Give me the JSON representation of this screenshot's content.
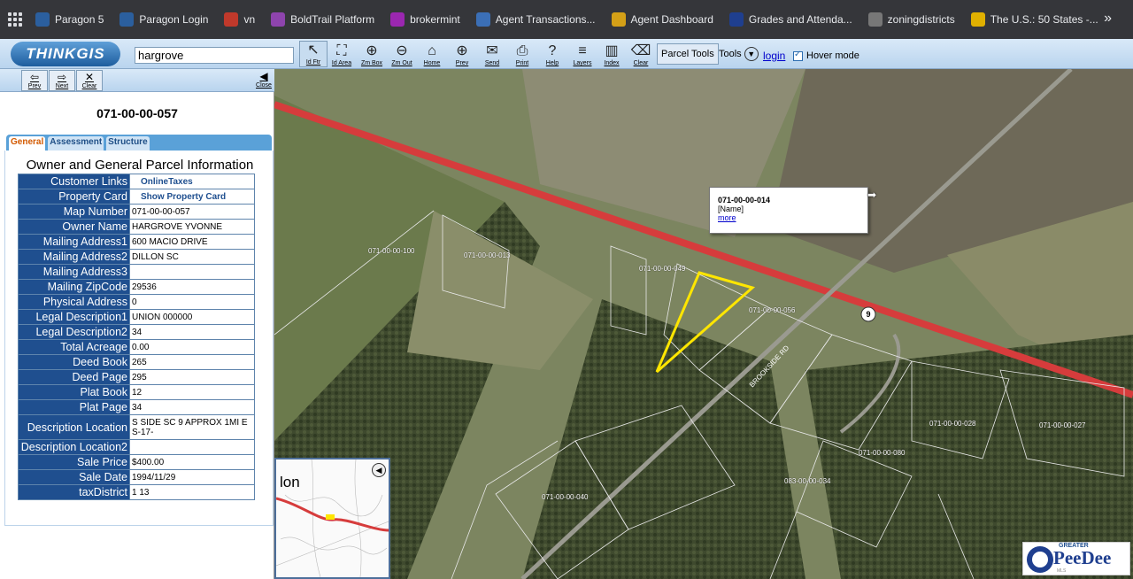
{
  "bookmarks": [
    {
      "label": "Paragon 5",
      "icon": "paragon-icon",
      "color": "#2b5f9e"
    },
    {
      "label": "Paragon Login",
      "icon": "paragon-icon",
      "color": "#2b5f9e"
    },
    {
      "label": "vn",
      "icon": "vn-icon",
      "color": "#c0392b"
    },
    {
      "label": "BoldTrail Platform",
      "icon": "boldtrail-icon",
      "color": "#8e44ad"
    },
    {
      "label": "brokermint",
      "icon": "brokermint-icon",
      "color": "#9b27b0"
    },
    {
      "label": "Agent Transactions...",
      "icon": "up-icon",
      "color": "#3b6fb6"
    },
    {
      "label": "Agent Dashboard",
      "icon": "m-icon",
      "color": "#d4a017"
    },
    {
      "label": "Grades and Attenda...",
      "icon": "sis-icon",
      "color": "#1f3f8f"
    },
    {
      "label": "zoningdistricts",
      "icon": "globe-icon",
      "color": "#777777"
    },
    {
      "label": "The U.S.: 50 States -...",
      "icon": "s-icon",
      "color": "#e0b000"
    }
  ],
  "toolbar": {
    "logo": "THINKGIS",
    "search_value": "hargrove",
    "buttons": [
      {
        "label": "Id Ftr",
        "icon": "↖"
      },
      {
        "label": "Id Area",
        "icon": "⛶"
      },
      {
        "label": "Zm Box",
        "icon": "⊕"
      },
      {
        "label": "Zm Out",
        "icon": "⊖"
      },
      {
        "label": "Home",
        "icon": "⌂"
      },
      {
        "label": "Prev",
        "icon": "⊕"
      },
      {
        "label": "Send",
        "icon": "✉"
      },
      {
        "label": "Print",
        "icon": "⎙"
      },
      {
        "label": "Help",
        "icon": "?"
      },
      {
        "label": "Layers",
        "icon": "≡"
      },
      {
        "label": "Index",
        "icon": "▥"
      },
      {
        "label": "Clear",
        "icon": "⌫"
      }
    ],
    "parcel_tools": "Parcel Tools",
    "tools": "Tools",
    "login": "login",
    "hover_mode": "Hover mode"
  },
  "panel_toolbar": {
    "prev": "Prev",
    "next": "Next",
    "clear": "Clear",
    "close": "Close"
  },
  "parcel": {
    "id": "071-00-00-057",
    "tabs": [
      "General",
      "Assessment",
      "Structure"
    ],
    "section_title": "Owner and General Parcel Information",
    "rows": [
      {
        "key": "Customer Links",
        "value": "OnlineTaxes",
        "link": true
      },
      {
        "key": "Property Card",
        "value": "Show Property Card",
        "link": true
      },
      {
        "key": "Map Number",
        "value": "071-00-00-057"
      },
      {
        "key": "Owner Name",
        "value": "HARGROVE YVONNE"
      },
      {
        "key": "Mailing Address1",
        "value": "600 MACIO DRIVE"
      },
      {
        "key": "Mailing Address2",
        "value": "DILLON SC"
      },
      {
        "key": "Mailing Address3",
        "value": ""
      },
      {
        "key": "Mailing ZipCode",
        "value": "29536"
      },
      {
        "key": "Physical Address",
        "value": "0"
      },
      {
        "key": "Legal Description1",
        "value": "UNION 000000"
      },
      {
        "key": "Legal Description2",
        "value": "34"
      },
      {
        "key": "Total Acreage",
        "value": "0.00"
      },
      {
        "key": "Deed Book",
        "value": "265"
      },
      {
        "key": "Deed Page",
        "value": "295"
      },
      {
        "key": "Plat Book",
        "value": "12"
      },
      {
        "key": "Plat Page",
        "value": "34"
      },
      {
        "key": "Description Location",
        "value": "S SIDE SC 9 APPROX 1MI E S-17-",
        "tall": true
      },
      {
        "key": "Description Location2",
        "value": ""
      },
      {
        "key": "Sale Price",
        "value": "$400.00"
      },
      {
        "key": "Sale Date",
        "value": "1994/11/29"
      },
      {
        "key": "taxDistrict",
        "value": "1 13"
      }
    ]
  },
  "map": {
    "labels": [
      "071-00-00-100",
      "071-00-00-013",
      "071-00-00-049",
      "071-00-00-056",
      "071-00-00-028",
      "071-00-00-027",
      "071-00-00-080",
      "083-00-00-034",
      "071-00-00-040"
    ],
    "route": "9",
    "road": "BROOKSIDE RD",
    "popup": {
      "id": "071-00-00-014",
      "name": "[Name]",
      "more": "more"
    },
    "overview_label": "lon"
  },
  "branding": {
    "greater": "GREATER",
    "name": "PeeDee",
    "sub": "MLS"
  }
}
